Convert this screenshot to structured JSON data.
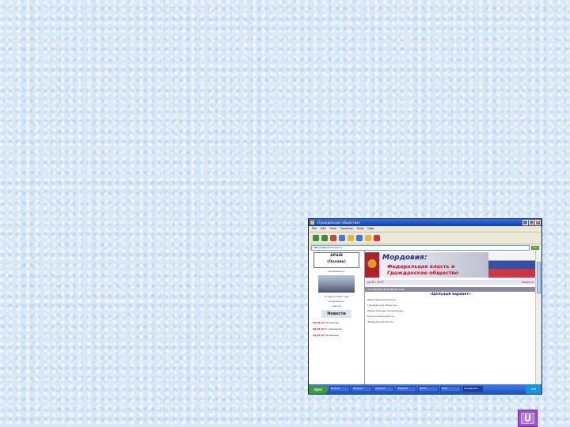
{
  "screenshot": {
    "window_title": "«Гражданское общество»",
    "menu": [
      "File",
      "Edit",
      "View",
      "Favorites",
      "Tools",
      "Help"
    ],
    "address": "http://www.mordovia.ru/",
    "go_label": "Go",
    "left": {
      "logo_line1": "АРШВ",
      "logo_line2": "(Онлайн)",
      "link1": "мордовия.ру",
      "photo_caption": "17 марта 2007 года",
      "link2": "мордовия.ру",
      "link3": "новости",
      "rlogo": "Новости",
      "news": [
        {
          "date": "25.03.07",
          "text": "Заседание"
        },
        {
          "date": "20.03.07",
          "text": "О совещании"
        },
        {
          "date": "19.03.07",
          "text": "Заседание"
        }
      ]
    },
    "banner": {
      "line1": "Мордовия:",
      "line2": "Федеральная власть и",
      "line3": "Гражданское общество"
    },
    "datebar": {
      "left": "ДАТА: 2007",
      "right": "Новости"
    },
    "graybar": "«Гражданское общество»",
    "heading": "«Цельный вариант»",
    "paragraphs": [
      "Общественная палата",
      "Гражданское общество",
      "Общественные организации",
      "Региональная власть",
      "Федеральная власть"
    ],
    "taskbar": {
      "start": "пуск",
      "items": [
        "Windows",
        "Интернет",
        "Документ",
        "Мордовия",
        "Проект",
        "Power",
        "Word",
        "Гражданское",
        "Сеть"
      ],
      "clock": "9:55"
    }
  },
  "colors": {
    "desktop_bg": "#d9e8f6",
    "nav_button": "#9a54c6",
    "banner_title": "#1c2e86",
    "banner_accent": "#c8102e"
  },
  "nav_button": {
    "icon": "u-return-icon"
  }
}
